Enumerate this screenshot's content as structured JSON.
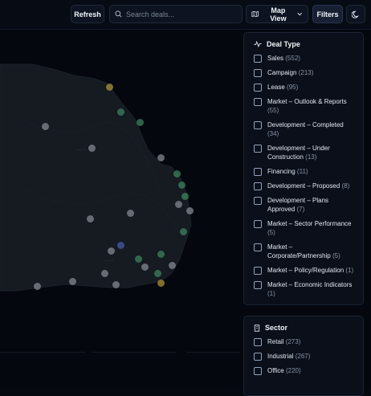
{
  "toolbar": {
    "refresh_label": "Refresh",
    "search_placeholder": "Search deals...",
    "map_view_label": "Map View",
    "filters_label": "Filters"
  },
  "deal_type": {
    "title": "Deal Type",
    "options": [
      {
        "label": "Sales",
        "count": "(552)"
      },
      {
        "label": "Campaign",
        "count": "(213)"
      },
      {
        "label": "Lease",
        "count": "(95)"
      },
      {
        "label": "Market – Outlook & Reports",
        "count": "(55)"
      },
      {
        "label": "Development – Completed",
        "count": "(34)"
      },
      {
        "label": "Development – Under Construction",
        "count": "(13)"
      },
      {
        "label": "Financing",
        "count": "(11)"
      },
      {
        "label": "Development – Proposed",
        "count": "(8)"
      },
      {
        "label": "Development – Plans Approved",
        "count": "(7)"
      },
      {
        "label": "Market – Sector Performance",
        "count": "(5)"
      },
      {
        "label": "Market – Corporate/Partnership",
        "count": "(5)"
      },
      {
        "label": "Market – Policy/Regulation",
        "count": "(1)"
      },
      {
        "label": "Market – Economic Indicators",
        "count": "(1)"
      }
    ]
  },
  "sector": {
    "title": "Sector",
    "options": [
      {
        "label": "Retail",
        "count": "(273)"
      },
      {
        "label": "Industrial",
        "count": "(267)"
      },
      {
        "label": "Office",
        "count": "(220)"
      }
    ]
  },
  "colors": {
    "marker_green": "#3f8a63",
    "marker_grey": "#8a9099",
    "marker_yellow": "#b59a3a",
    "marker_blue": "#4a5fb0"
  },
  "icons": {
    "search": "magnifier",
    "map_view": "folded-map",
    "filters": "none",
    "theme_toggle": "moon",
    "deal_type": "trend-line",
    "sector": "building"
  }
}
